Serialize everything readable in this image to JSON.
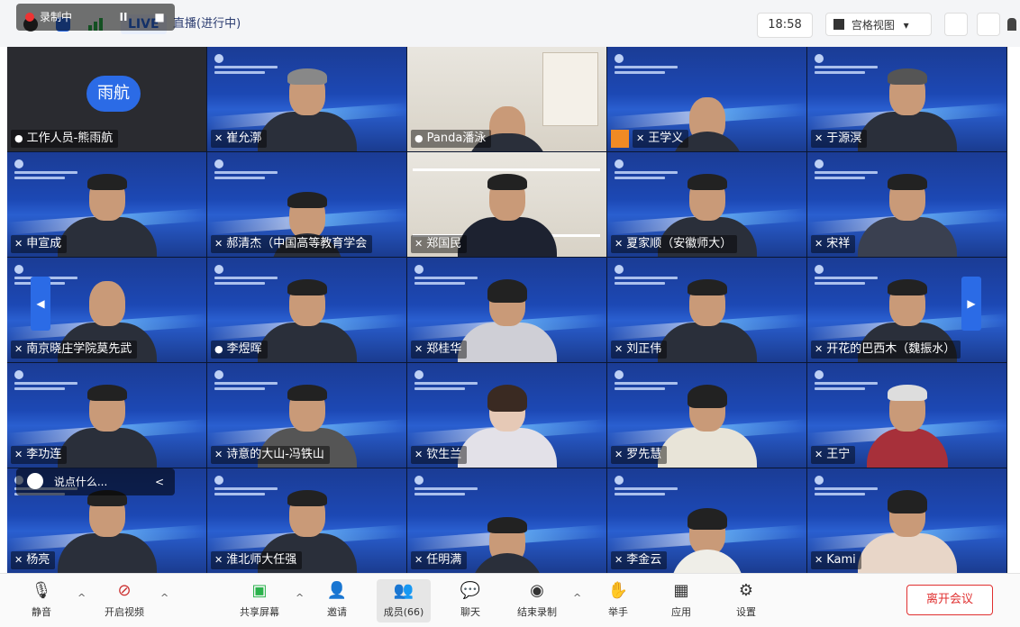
{
  "topbar": {
    "live_label": "LIVE",
    "live_status": "直播(进行中)",
    "time": "18:58",
    "view_mode": "宫格视图"
  },
  "recording": {
    "label": "录制中",
    "pause_glyph": "II",
    "stop_glyph": "■"
  },
  "chat_input": {
    "placeholder": "说点什么...",
    "collapse_glyph": "<"
  },
  "nav": {
    "prev_glyph": "◀",
    "next_glyph": "▶"
  },
  "participants": [
    {
      "name": "工作人员-熊雨航",
      "avatar": "雨航"
    },
    {
      "name": "崔允漷"
    },
    {
      "name": "Panda潘泳"
    },
    {
      "name": "王学义"
    },
    {
      "name": "于源溟"
    },
    {
      "name": "申宣成"
    },
    {
      "name": "郝清杰（中国高等教育学会"
    },
    {
      "name": "郑国民"
    },
    {
      "name": "夏家顺（安徽师大）"
    },
    {
      "name": "宋祥"
    },
    {
      "name": "南京晓庄学院莫先武"
    },
    {
      "name": "李煜晖"
    },
    {
      "name": "郑桂华"
    },
    {
      "name": "刘正伟"
    },
    {
      "name": "开花的巴西木（魏振水）"
    },
    {
      "name": "李功连"
    },
    {
      "name": "诗意的大山-冯铁山"
    },
    {
      "name": "钦生兰"
    },
    {
      "name": "罗先慧"
    },
    {
      "name": "王宁"
    },
    {
      "name": "杨亮"
    },
    {
      "name": "淮北师大任强"
    },
    {
      "name": "任明满"
    },
    {
      "name": "李金云"
    },
    {
      "name": "Kami"
    }
  ],
  "toolbar": {
    "mute": "静音",
    "start_video": "开启视频",
    "share_screen": "共享屏幕",
    "invite": "邀请",
    "members": "成员(66)",
    "chat": "聊天",
    "cloud_record": "结束录制",
    "raise_hand": "举手",
    "apps": "应用",
    "settings": "设置",
    "leave": "离开会议"
  },
  "colors": {
    "accent": "#2b6be6",
    "leave": "#e03030",
    "tile_bg": "#1c48b4"
  }
}
